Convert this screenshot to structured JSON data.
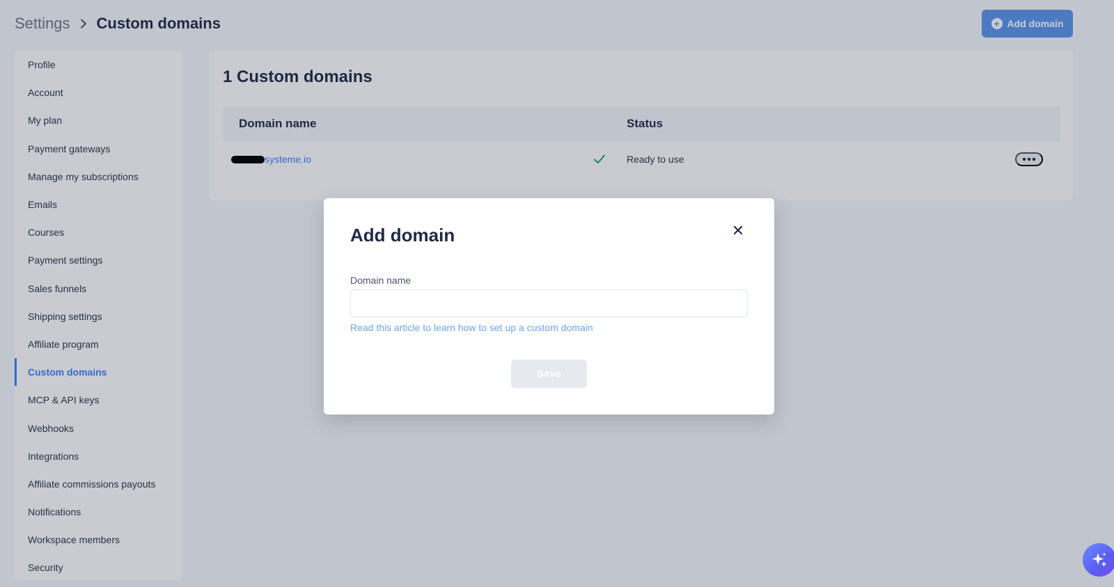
{
  "header": {
    "breadcrumb_root": "Settings",
    "breadcrumb_current": "Custom domains",
    "add_button_label": "Add domain"
  },
  "sidebar": {
    "active_index": 11,
    "items": [
      {
        "label": "Profile"
      },
      {
        "label": "Account"
      },
      {
        "label": "My plan"
      },
      {
        "label": "Payment gateways"
      },
      {
        "label": "Manage my subscriptions"
      },
      {
        "label": "Emails"
      },
      {
        "label": "Courses"
      },
      {
        "label": "Payment settings"
      },
      {
        "label": "Sales funnels"
      },
      {
        "label": "Shipping settings"
      },
      {
        "label": "Affiliate program"
      },
      {
        "label": "Custom domains"
      },
      {
        "label": "MCP & API keys"
      },
      {
        "label": "Webhooks"
      },
      {
        "label": "Integrations"
      },
      {
        "label": "Affiliate commissions payouts"
      },
      {
        "label": "Notifications"
      },
      {
        "label": "Workspace members"
      },
      {
        "label": "Security"
      }
    ]
  },
  "main": {
    "title": "1 Custom domains",
    "columns": {
      "domain": "Domain name",
      "status": "Status"
    },
    "rows": [
      {
        "domain": "systeme.io",
        "status": "Ready to use",
        "status_icon": "check-icon"
      }
    ]
  },
  "modal": {
    "title": "Add domain",
    "field_label": "Domain name",
    "field_value": "",
    "field_placeholder": "",
    "help_link": "Read this article to learn how to set up a custom domain",
    "save_label": "Save"
  },
  "colors": {
    "accent": "#5b95ea",
    "link": "#3b82f6",
    "success": "#22a06b",
    "title": "#1f2a44"
  }
}
